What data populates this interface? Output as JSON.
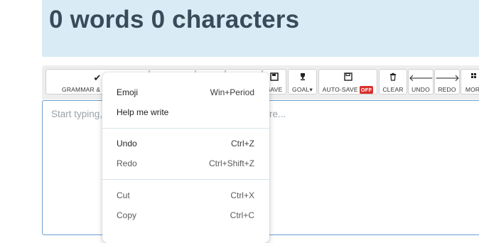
{
  "counter": "0 words 0 characters",
  "toolbar": {
    "grammar_label": "GRAMMAR & SPELLING",
    "save_label": "SAVE",
    "goal_label": "GOAL",
    "autosave_label": "AUTO-SAVE",
    "autosave_state": "OFF",
    "clear_label": "CLEAR",
    "undo_label": "UNDO",
    "redo_label": "REDO",
    "more_label": "MORE"
  },
  "editor": {
    "placeholder_start": "Start typing,",
    "placeholder_end": "re..."
  },
  "context_menu": {
    "items": [
      {
        "label": "Emoji",
        "shortcut": "Win+Period"
      },
      {
        "label": "Help me write",
        "shortcut": ""
      },
      {
        "label": "Undo",
        "shortcut": "Ctrl+Z"
      },
      {
        "label": "Redo",
        "shortcut": "Ctrl+Shift+Z"
      },
      {
        "label": "Cut",
        "shortcut": "Ctrl+X"
      },
      {
        "label": "Copy",
        "shortcut": "Ctrl+C"
      }
    ]
  },
  "colors": {
    "header_bg": "#d9ecf5",
    "counter_text": "#3b4a5a",
    "off_badge": "#d9302c",
    "editor_border": "#6a9fd0"
  },
  "icons": {
    "grammar": "checkmark-icon",
    "save": "save-icon",
    "goal": "trophy-icon",
    "autosave": "floppy-icon",
    "clear": "trash-icon",
    "undo": "arrow-left-icon",
    "redo": "arrow-right-icon"
  }
}
